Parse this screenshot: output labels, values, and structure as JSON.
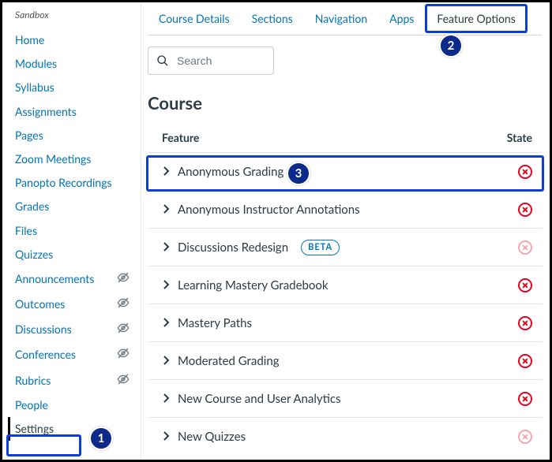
{
  "sidebar": {
    "title": "Sandbox",
    "items": [
      {
        "label": "Home",
        "hidden": false
      },
      {
        "label": "Modules",
        "hidden": false
      },
      {
        "label": "Syllabus",
        "hidden": false
      },
      {
        "label": "Assignments",
        "hidden": false
      },
      {
        "label": "Pages",
        "hidden": false
      },
      {
        "label": "Zoom Meetings",
        "hidden": false
      },
      {
        "label": "Panopto Recordings",
        "hidden": false
      },
      {
        "label": "Grades",
        "hidden": false
      },
      {
        "label": "Files",
        "hidden": false
      },
      {
        "label": "Quizzes",
        "hidden": false
      },
      {
        "label": "Announcements",
        "hidden": true
      },
      {
        "label": "Outcomes",
        "hidden": true
      },
      {
        "label": "Discussions",
        "hidden": true
      },
      {
        "label": "Conferences",
        "hidden": true
      },
      {
        "label": "Rubrics",
        "hidden": true
      },
      {
        "label": "People",
        "hidden": false
      },
      {
        "label": "Settings",
        "hidden": false,
        "active": true
      }
    ]
  },
  "tabs": [
    {
      "label": "Course Details"
    },
    {
      "label": "Sections"
    },
    {
      "label": "Navigation"
    },
    {
      "label": "Apps"
    },
    {
      "label": "Feature Options",
      "active": true
    }
  ],
  "search": {
    "placeholder": "Search"
  },
  "section_title": "Course",
  "table": {
    "col_feature": "Feature",
    "col_state": "State",
    "rows": [
      {
        "name": "Anonymous Grading",
        "beta": false,
        "faded": false
      },
      {
        "name": "Anonymous Instructor Annotations",
        "beta": false,
        "faded": false
      },
      {
        "name": "Discussions Redesign",
        "beta": true,
        "faded": true
      },
      {
        "name": "Learning Mastery Gradebook",
        "beta": false,
        "faded": false
      },
      {
        "name": "Mastery Paths",
        "beta": false,
        "faded": false
      },
      {
        "name": "Moderated Grading",
        "beta": false,
        "faded": false
      },
      {
        "name": "New Course and User Analytics",
        "beta": false,
        "faded": false
      },
      {
        "name": "New Quizzes",
        "beta": false,
        "faded": true
      }
    ]
  },
  "beta_label": "BETA",
  "callouts": {
    "b1": "1",
    "b2": "2",
    "b3": "3"
  }
}
